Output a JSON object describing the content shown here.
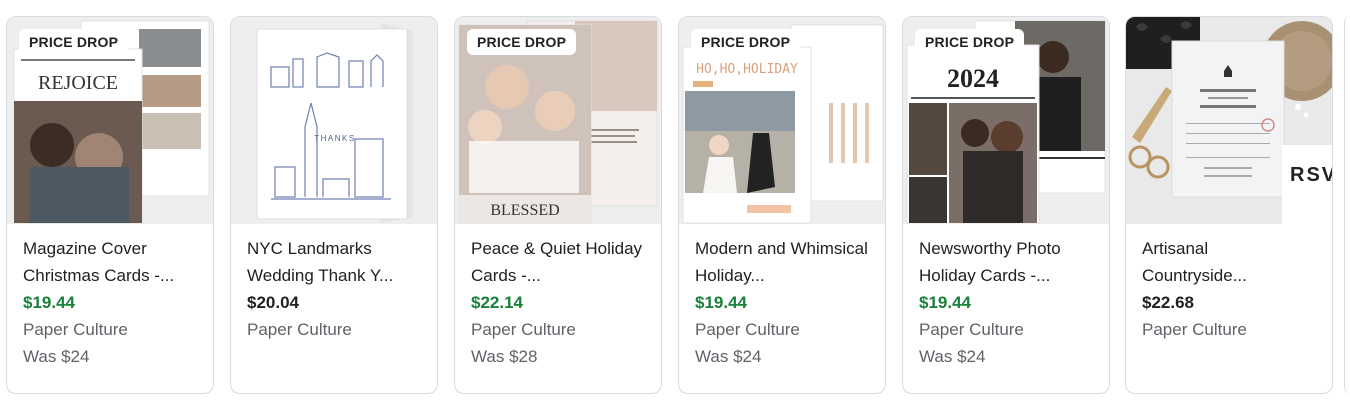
{
  "products": [
    {
      "badge": "PRICE DROP",
      "title": "Magazine Cover Christmas Cards -...",
      "price": "$19.44",
      "price_color": "#188038",
      "merchant": "Paper Culture",
      "was": "Was $24",
      "art_text": "REJOICE"
    },
    {
      "badge": "",
      "title": "NYC Landmarks Wedding Thank Y...",
      "price": "$20.04",
      "price_color": "#202124",
      "merchant": "Paper Culture",
      "was": "",
      "art_text": "THANKS"
    },
    {
      "badge": "PRICE DROP",
      "title": "Peace & Quiet Holiday Cards -...",
      "price": "$22.14",
      "price_color": "#188038",
      "merchant": "Paper Culture",
      "was": "Was $28",
      "art_text": "BLESSED"
    },
    {
      "badge": "PRICE DROP",
      "title": "Modern and Whimsical Holiday...",
      "price": "$19.44",
      "price_color": "#188038",
      "merchant": "Paper Culture",
      "was": "Was $24",
      "art_text": "HO,HO,HOLIDAY"
    },
    {
      "badge": "PRICE DROP",
      "title": "Newsworthy Photo Holiday Cards -...",
      "price": "$19.44",
      "price_color": "#188038",
      "merchant": "Paper Culture",
      "was": "Was $24",
      "art_text": "2024"
    },
    {
      "badge": "",
      "title": "Artisanal Countryside...",
      "price": "$22.68",
      "price_color": "#202124",
      "merchant": "Paper Culture",
      "was": "",
      "art_text": "RSV"
    }
  ]
}
